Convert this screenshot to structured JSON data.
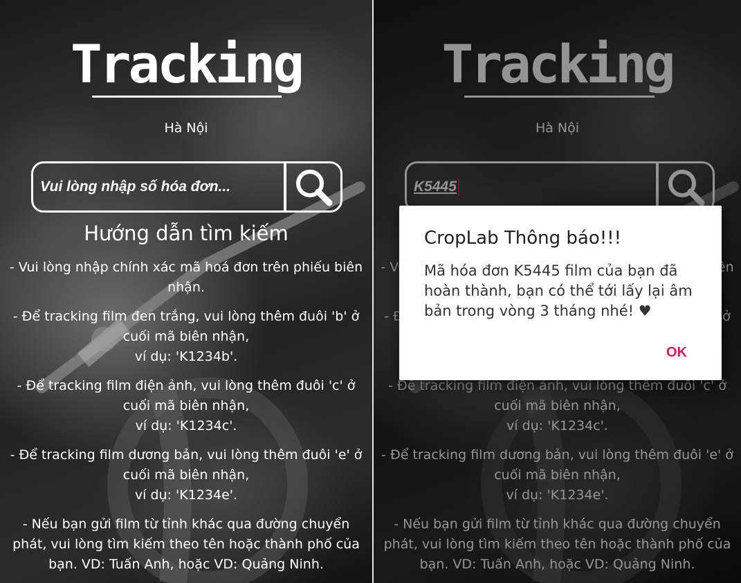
{
  "app": {
    "title": "Tracking",
    "city": "Hà Nội",
    "search": {
      "placeholder": "Vui lòng nhập số hóa đơn...",
      "value": "K5445",
      "button_icon": "search-icon"
    },
    "guide": {
      "title": "Hướng dẫn tìm kiếm",
      "items": [
        [
          "- Vui lòng nhập chính xác mã hoá đơn trên phiếu biên nhận."
        ],
        [
          "- Để tracking film đen trắng, vui lòng thêm đuôi 'b' ở cuối mã biên nhận,",
          "ví dụ: 'K1234b'."
        ],
        [
          "- Để tracking film điện ảnh, vui lòng thêm đuôi 'c' ở cuối mã biên nhận,",
          "ví dụ: 'K1234c'."
        ],
        [
          "- Để tracking film dương bản, vui lòng thêm đuôi 'e' ở cuối mã biên nhận,",
          "ví dụ: 'K1234e'."
        ],
        [
          "- Nếu bạn gửi film từ tỉnh khác qua đường chuyển phát, vui lòng tìm kiếm theo tên hoặc thành phố của bạn. VD: Tuấn Anh, hoặc VD: Quảng Ninh."
        ]
      ]
    }
  },
  "dialog": {
    "title": "CropLab Thông báo!!!",
    "message": "Mã hóa đơn K5445 film của bạn đã hoàn thành, bạn có thể tới lấy lại âm bản trong vòng 3 tháng nhé! ♥",
    "ok_label": "OK"
  },
  "colors": {
    "accent": "#d81b60",
    "text_on_photo": "#ffffff",
    "dialog_bg": "#ffffff"
  }
}
